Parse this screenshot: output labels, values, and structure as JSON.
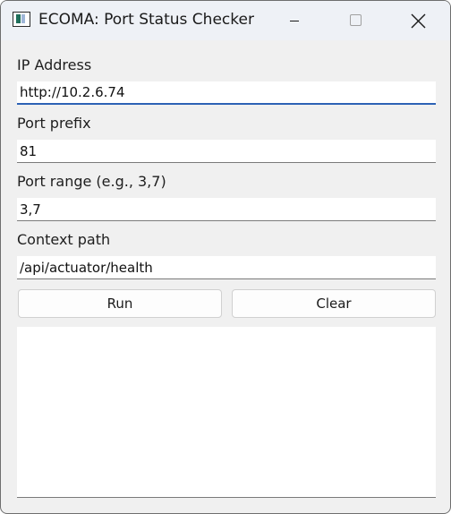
{
  "window": {
    "title": "ECOMA: Port Status Checker",
    "icon": "app-window-icon"
  },
  "form": {
    "ip_label": "IP Address",
    "ip_value": "http://10.2.6.74",
    "prefix_label": "Port prefix",
    "prefix_value": "81",
    "range_label": "Port range (e.g., 3,7)",
    "range_value": "3,7",
    "context_label": "Context path",
    "context_value": "/api/actuator/health"
  },
  "buttons": {
    "run_label": "Run",
    "clear_label": "Clear"
  },
  "output": {
    "text": ""
  }
}
